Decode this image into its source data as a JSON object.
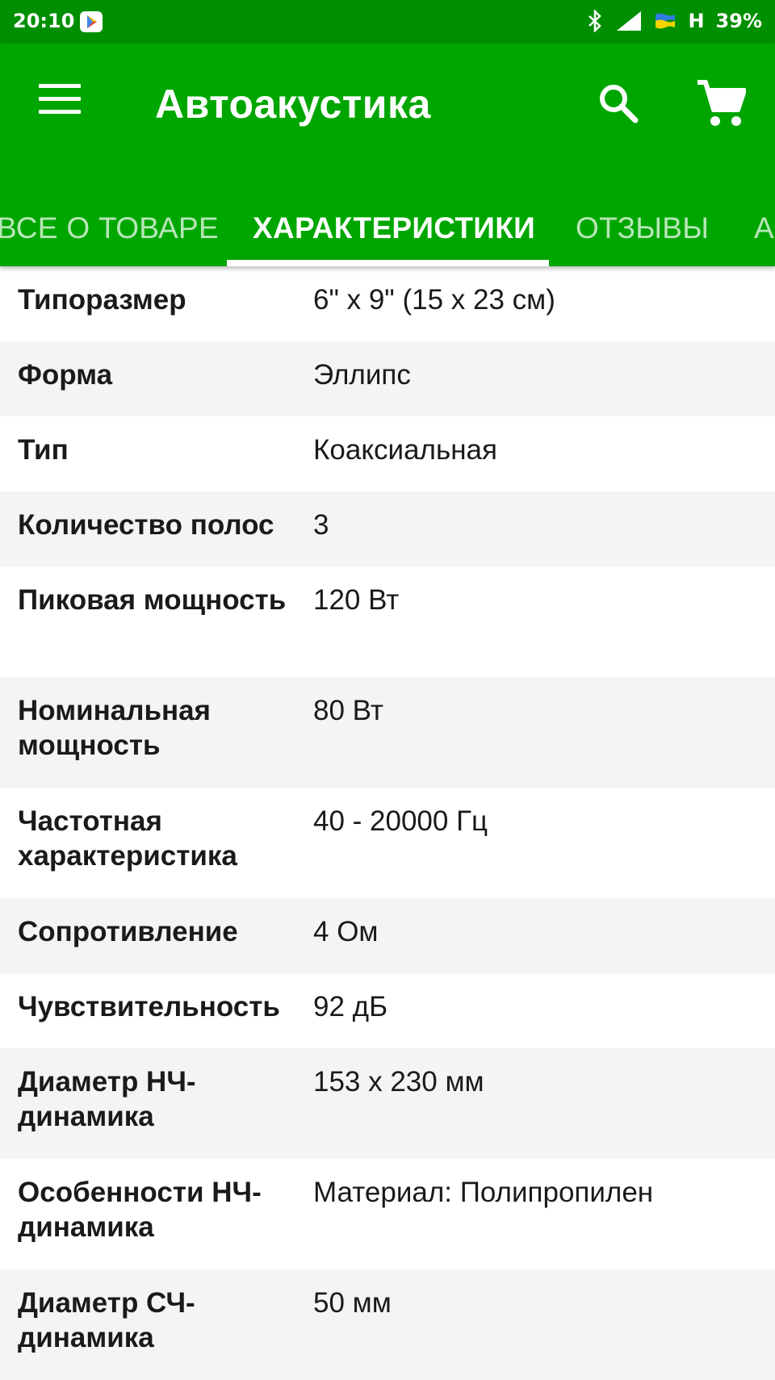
{
  "status": {
    "time": "20:10",
    "network": "H",
    "battery": "39%"
  },
  "appbar": {
    "title": "Автоакустика",
    "icons": [
      "menu-icon",
      "search-icon",
      "cart-icon"
    ]
  },
  "tabs": [
    {
      "label": "ВСЕ О ТОВАРЕ",
      "active": false
    },
    {
      "label": "ХАРАКТЕРИСТИКИ",
      "active": true
    },
    {
      "label": "ОТЗЫВЫ",
      "active": false
    },
    {
      "label": "А",
      "active": false
    }
  ],
  "specs": [
    {
      "label": "Типоразмер",
      "value": "6\" x 9\" (15 x 23 см)"
    },
    {
      "label": "Форма",
      "value": "Эллипс"
    },
    {
      "label": "Тип",
      "value": "Коаксиальная"
    },
    {
      "label": "Количество полос",
      "value": "3"
    },
    {
      "label": "Пиковая мощность",
      "value": "120 Вт"
    },
    {
      "label": "Номинальная мощность",
      "value": "80 Вт"
    },
    {
      "label": "Частотная характеристика",
      "value": "40 - 20000 Гц"
    },
    {
      "label": "Сопротивление",
      "value": "4 Ом"
    },
    {
      "label": "Чувствительность",
      "value": "92 дБ"
    },
    {
      "label": "Диаметр НЧ-динамика",
      "value": "153 x 230 мм"
    },
    {
      "label": "Особенности НЧ-динамика",
      "value": "Материал: Полипропилен"
    },
    {
      "label": "Диаметр СЧ-динамика",
      "value": "50 мм"
    }
  ],
  "colors": {
    "statusbar": "#008f00",
    "appbar": "#00a600",
    "row_alt": "#f4f4f4"
  }
}
